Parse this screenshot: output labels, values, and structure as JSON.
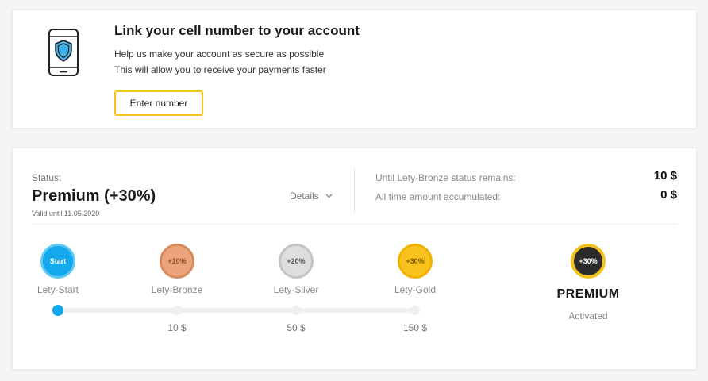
{
  "phone_card": {
    "title": "Link your cell number to your account",
    "line1": "Help us make your account as secure as possible",
    "line2": "This will allow you to receive your payments faster",
    "button_label": "Enter number"
  },
  "status_card": {
    "status_label": "Status:",
    "status_name": "Premium (+30%)",
    "valid_until": "Valid until 11.05.2020",
    "details_label": "Details",
    "info": [
      {
        "label": "Until Lety-Bronze status remains:",
        "value": "10 $"
      },
      {
        "label": "All time amount accumulated:",
        "value": "0 $"
      }
    ],
    "levels": [
      {
        "badge": "Start",
        "name": "Lety-Start"
      },
      {
        "badge": "+10%",
        "name": "Lety-Bronze",
        "amount": "10 $"
      },
      {
        "badge": "+20%",
        "name": "Lety-Silver",
        "amount": "50 $"
      },
      {
        "badge": "+30%",
        "name": "Lety-Gold",
        "amount": "150 $"
      }
    ],
    "premium": {
      "badge": "+30%",
      "title": "PREMIUM",
      "subtitle": "Activated"
    },
    "progress": 0
  },
  "colors": {
    "accent_yellow": "#f4c21d",
    "start_blue": "#14a9ec",
    "bronze": "#eca47c",
    "silver": "#dedede",
    "gold": "#f9c21d",
    "premium_dark": "#2b2b2b"
  },
  "icons": {
    "phone": "phone-shield-icon",
    "details": "chevron-down-icon"
  }
}
